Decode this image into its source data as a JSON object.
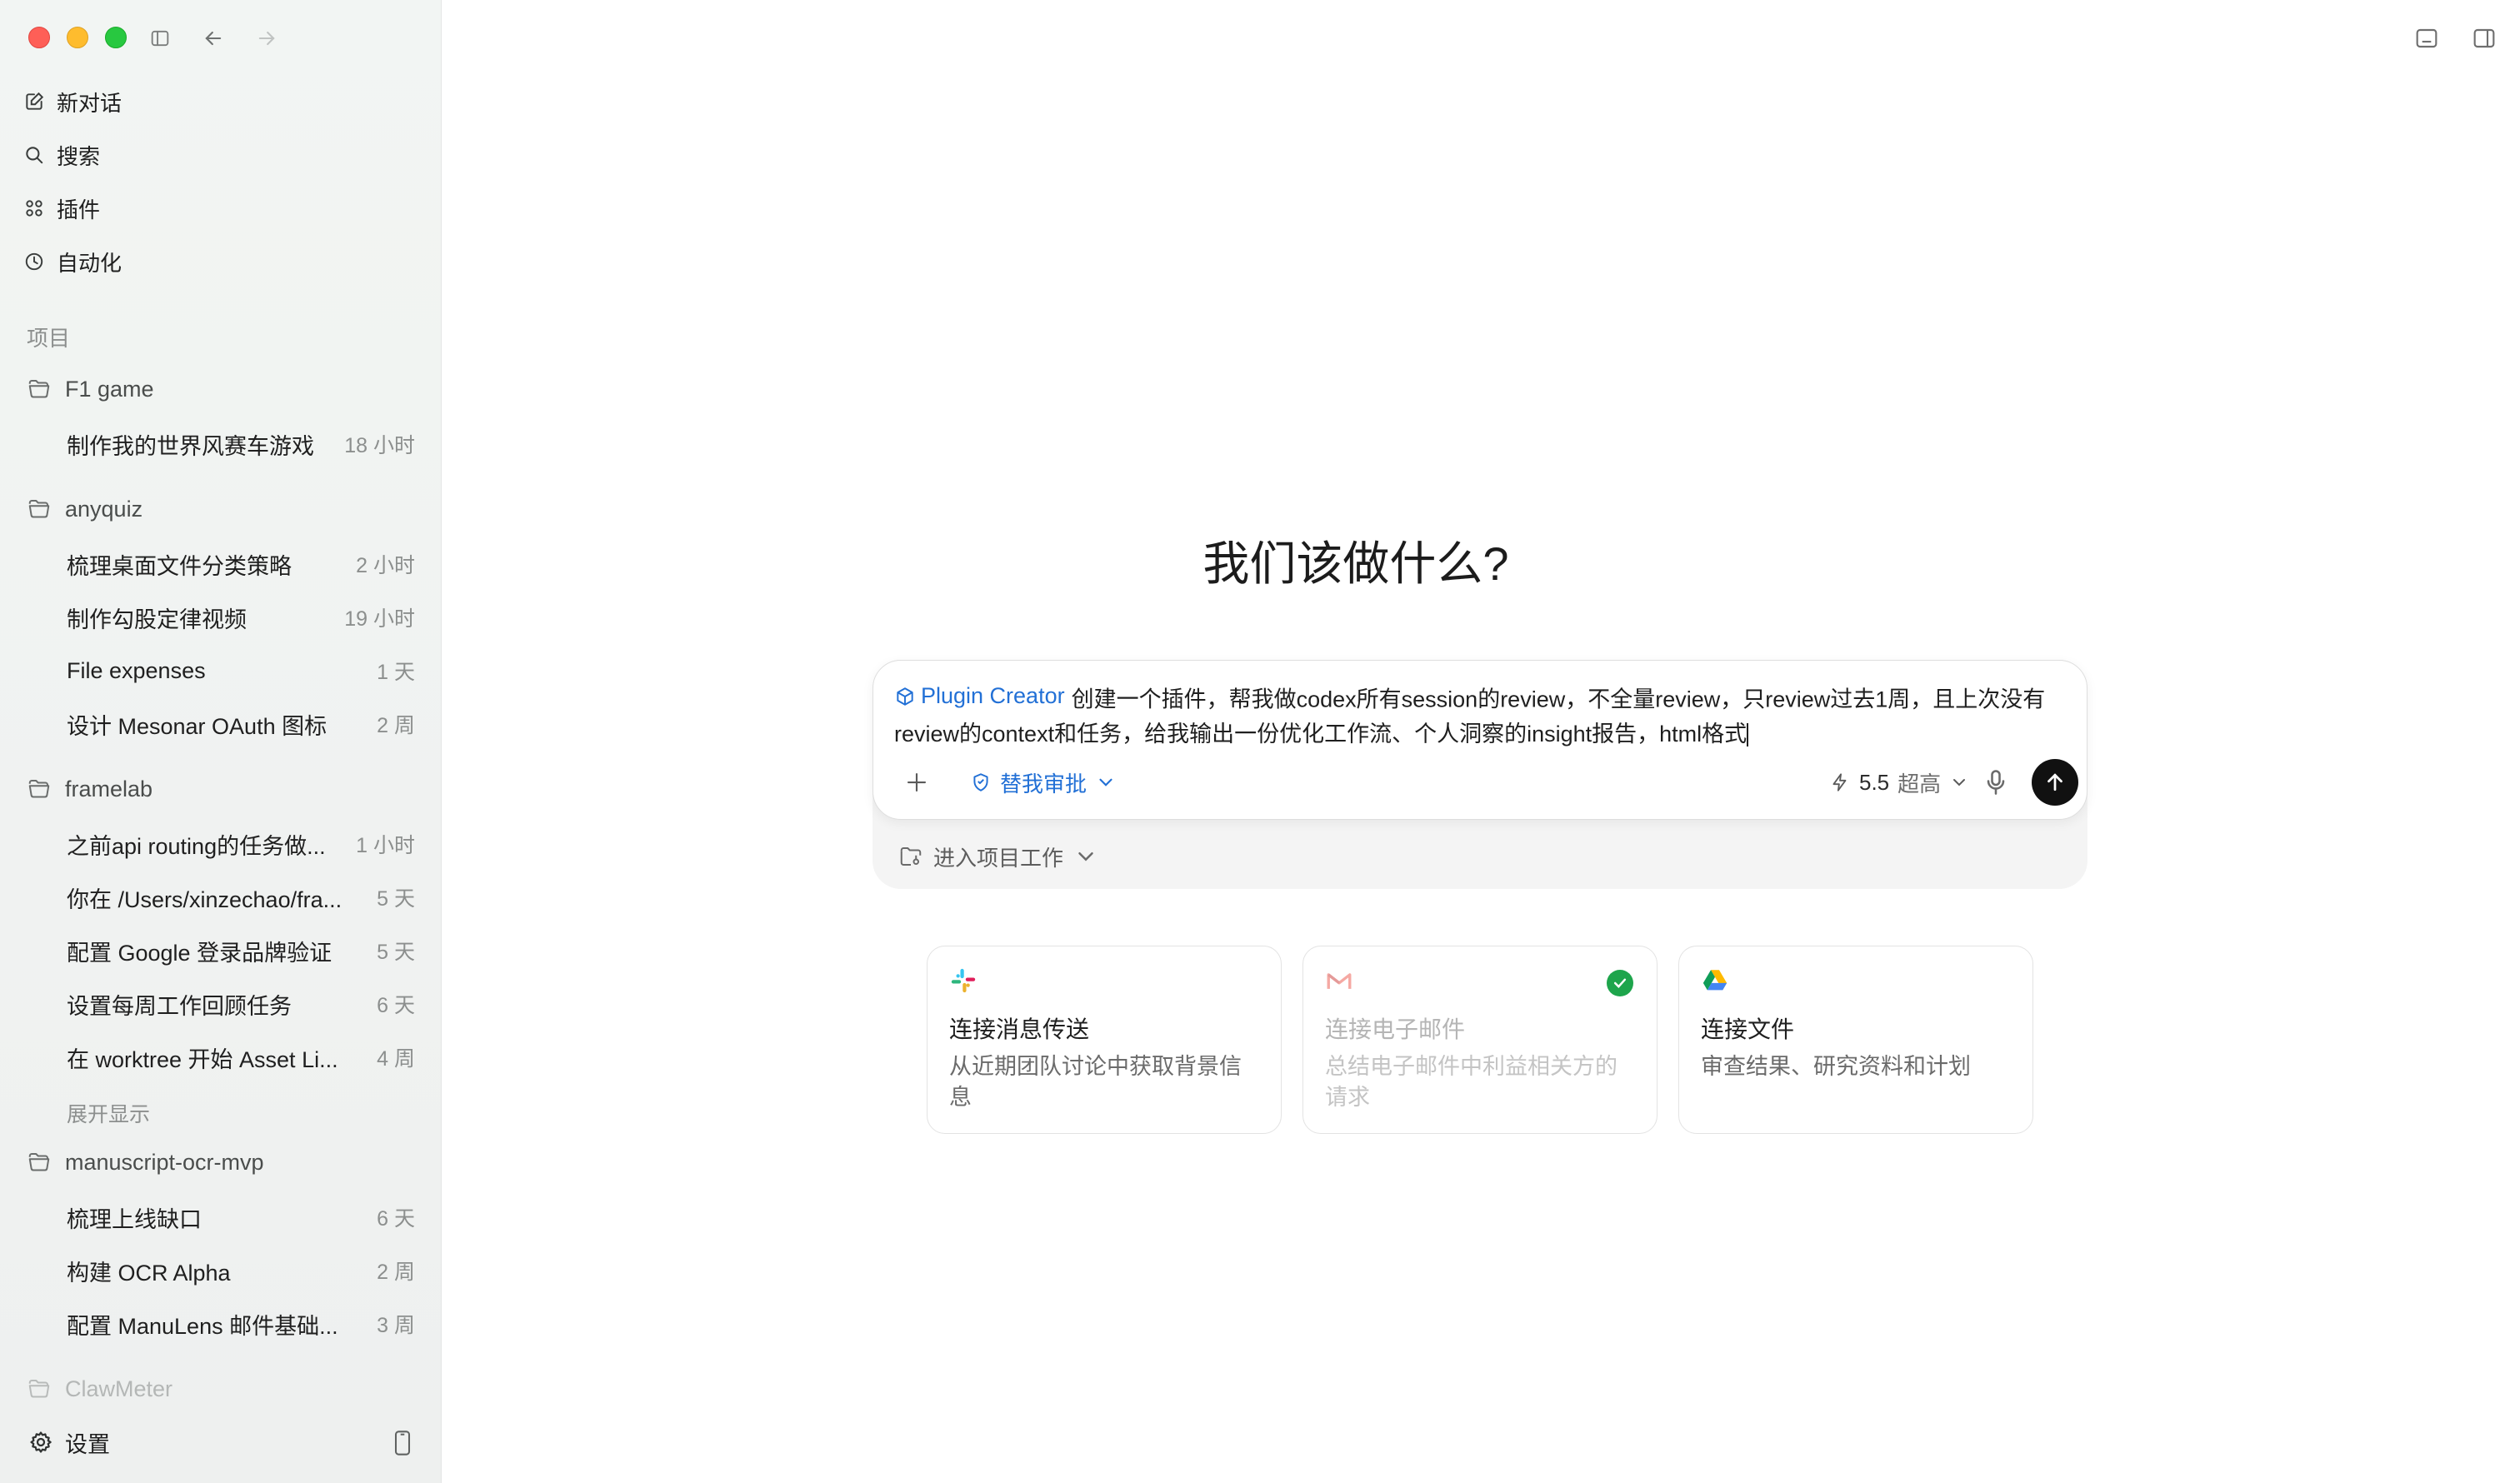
{
  "sidebar": {
    "nav": [
      {
        "label": "新对话",
        "icon": "compose-icon"
      },
      {
        "label": "搜索",
        "icon": "search-icon"
      },
      {
        "label": "插件",
        "icon": "grid-icon"
      },
      {
        "label": "自动化",
        "icon": "clock-icon"
      }
    ],
    "section_label": "项目",
    "projects": [
      {
        "name": "F1 game",
        "threads": [
          {
            "title": "制作我的世界风赛车游戏",
            "time": "18 小时"
          }
        ]
      },
      {
        "name": "anyquiz",
        "threads": [
          {
            "title": "梳理桌面文件分类策略",
            "time": "2 小时"
          },
          {
            "title": "制作勾股定律视频",
            "time": "19 小时"
          },
          {
            "title": "File expenses",
            "time": "1 天"
          },
          {
            "title": "设计 Mesonar OAuth 图标",
            "time": "2 周"
          }
        ]
      },
      {
        "name": "framelab",
        "threads": [
          {
            "title": "之前api routing的任务做...",
            "time": "1 小时"
          },
          {
            "title": "你在 /Users/xinzechao/fra...",
            "time": "5 天"
          },
          {
            "title": "配置 Google 登录品牌验证",
            "time": "5 天"
          },
          {
            "title": "设置每周工作回顾任务",
            "time": "6 天"
          },
          {
            "title": "在 worktree 开始 Asset Li...",
            "time": "4 周"
          }
        ],
        "expand_label": "展开显示"
      },
      {
        "name": "manuscript-ocr-mvp",
        "threads": [
          {
            "title": "梳理上线缺口",
            "time": "6 天"
          },
          {
            "title": "构建 OCR Alpha",
            "time": "2 周"
          },
          {
            "title": "配置 ManuLens 邮件基础...",
            "time": "3 周"
          }
        ]
      },
      {
        "name": "ClawMeter",
        "threads": []
      }
    ],
    "settings_label": "设置"
  },
  "main": {
    "headline": "我们该做什么?",
    "composer": {
      "plugin_tag": "Plugin Creator",
      "prompt_text": "创建一个插件，帮我做codex所有session的review，不全量review，只review过去1周，且上次没有review的context和任务，给我输出一份优化工作流、个人洞察的insight报告，html格式",
      "approval_label": "替我审批",
      "model_version": "5.5",
      "effort_label": "超高"
    },
    "project_mode_label": "进入项目工作",
    "cards": [
      {
        "title": "连接消息传送",
        "desc": "从近期团队讨论中获取背景信息",
        "icon": "slack-icon",
        "connected": false
      },
      {
        "title": "连接电子邮件",
        "desc": "总结电子邮件中利益相关方的请求",
        "icon": "gmail-icon",
        "connected": true
      },
      {
        "title": "连接文件",
        "desc": "审查结果、研究资料和计划",
        "icon": "google-drive-icon",
        "connected": false
      }
    ]
  },
  "colors": {
    "accent": "#2270d6",
    "sidebar_bg": "#f0f2f1",
    "send_button": "#111111",
    "connected": "#1ea54c"
  }
}
